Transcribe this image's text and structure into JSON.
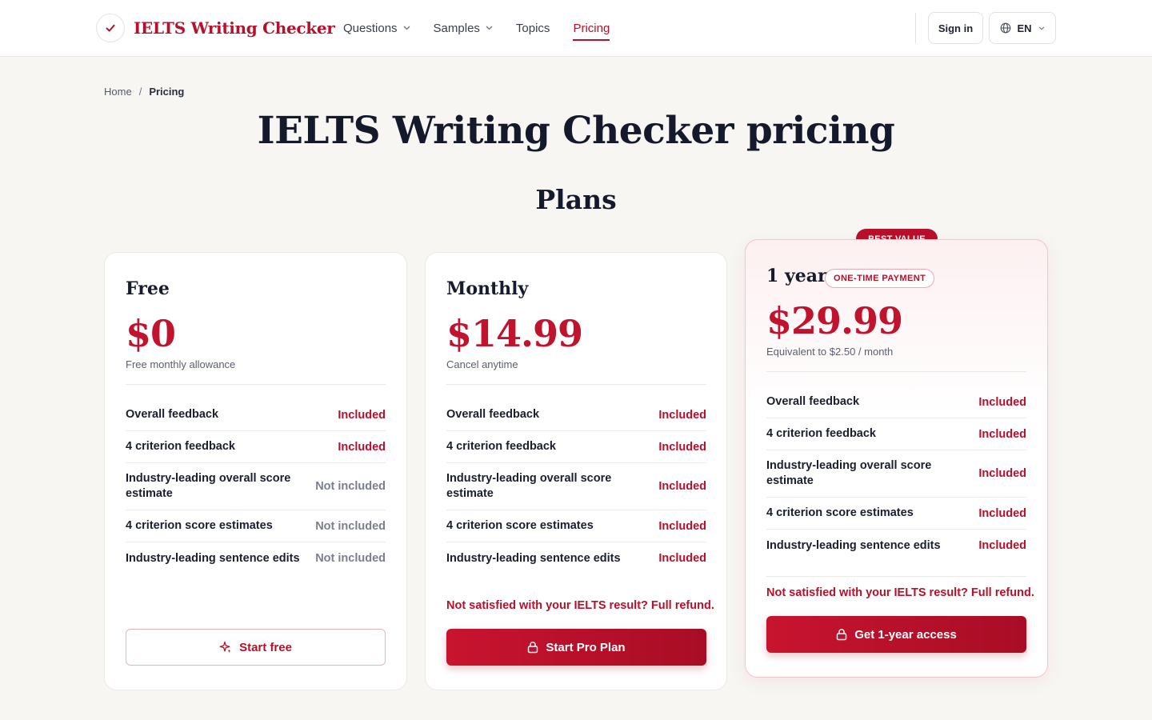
{
  "brand": {
    "name": "IELTS Writing Checker",
    "accent": "#b8102a"
  },
  "nav": {
    "items": [
      {
        "label": "Questions",
        "has_dropdown": true
      },
      {
        "label": "Samples",
        "has_dropdown": true
      },
      {
        "label": "Topics",
        "has_dropdown": false
      },
      {
        "label": "Pricing",
        "has_dropdown": false,
        "active": true
      }
    ],
    "signin_label": "Sign in",
    "language": "EN"
  },
  "breadcrumb": {
    "home": "Home",
    "separator": "/",
    "current": "Pricing"
  },
  "page_title": "IELTS Writing Checker pricing",
  "section_title": "Plans",
  "plans": [
    {
      "name": "Free",
      "price": "$0",
      "subtitle": "Free monthly allowance",
      "features": [
        {
          "label": "Overall feedback",
          "status": "Included"
        },
        {
          "label": "4 criterion feedback",
          "status": "Included"
        },
        {
          "label": "Industry-leading overall score estimate",
          "status": "Not included"
        },
        {
          "label": "4 criterion score estimates",
          "status": "Not included"
        },
        {
          "label": "Industry-leading sentence edits",
          "status": "Not included"
        }
      ],
      "cta": "Start free",
      "cta_icon": "sparkle-icon"
    },
    {
      "name": "Monthly",
      "price": "$14.99",
      "subtitle": "Cancel anytime",
      "features": [
        {
          "label": "Overall feedback",
          "status": "Included"
        },
        {
          "label": "4 criterion feedback",
          "status": "Included"
        },
        {
          "label": "Industry-leading overall score estimate",
          "status": "Included"
        },
        {
          "label": "4 criterion score estimates",
          "status": "Included"
        },
        {
          "label": "Industry-leading sentence edits",
          "status": "Included"
        }
      ],
      "refund": "Not satisfied with your IELTS result? Full refund.",
      "cta": "Start Pro Plan",
      "cta_icon": "lock-icon"
    },
    {
      "name": "1 year",
      "badge": "BEST VALUE",
      "pill": "ONE-TIME PAYMENT",
      "price": "$29.99",
      "subtitle": "Equivalent to $2.50 / month",
      "features": [
        {
          "label": "Overall feedback",
          "status": "Included"
        },
        {
          "label": "4 criterion feedback",
          "status": "Included"
        },
        {
          "label": "Industry-leading overall score estimate",
          "status": "Included"
        },
        {
          "label": "4 criterion score estimates",
          "status": "Included"
        },
        {
          "label": "Industry-leading sentence edits",
          "status": "Included"
        }
      ],
      "refund": "Not satisfied with your IELTS result? Full refund.",
      "cta": "Get 1-year access",
      "cta_icon": "lock-icon"
    }
  ]
}
